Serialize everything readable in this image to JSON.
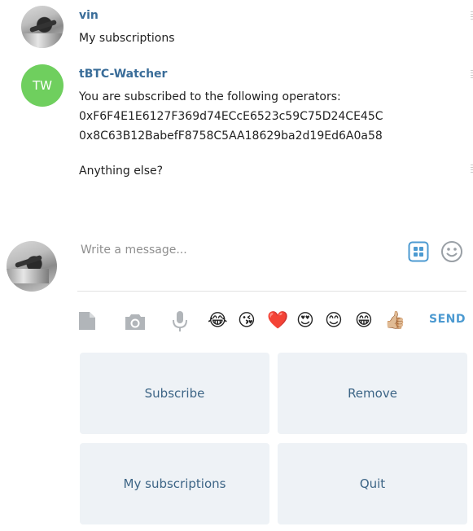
{
  "messages": [
    {
      "sender": "vin",
      "avatar": "user-photo",
      "lines": [
        "My subscriptions"
      ]
    },
    {
      "sender": "tBTC-Watcher",
      "avatar_initials": "TW",
      "avatar_color": "#6fcf5e",
      "lines": [
        "You are subscribed to the following operators:",
        "0xF6F4E1E6127F369d74ECcE6523c59C75D24CE45C",
        "0x8C63B12BabefF8758C5AA18629ba2d19Ed6A0a58"
      ],
      "followup": "Anything else?"
    }
  ],
  "compose": {
    "placeholder": "Write a message...",
    "send_label": "SEND"
  },
  "toolbar": {
    "icons": [
      "file-icon",
      "camera-icon",
      "microphone-icon"
    ],
    "emojis": [
      "😂",
      "😘",
      "❤️",
      "😍",
      "😊",
      "😁",
      "👍🏼"
    ]
  },
  "keyboard": {
    "buttons": [
      "Subscribe",
      "Remove",
      "My subscriptions",
      "Quit"
    ]
  },
  "colors": {
    "name": "#3a6d99",
    "send": "#4c9ad1",
    "keyboard_bg": "#eef2f6",
    "keyboard_text": "#3d6586"
  }
}
